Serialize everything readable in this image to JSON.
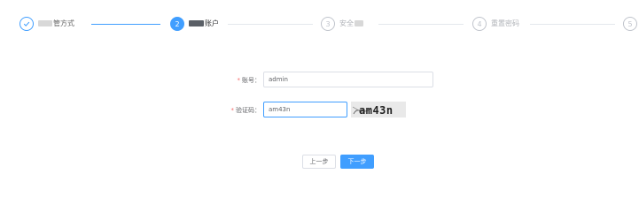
{
  "steps": [
    {
      "index": "1",
      "title": "管方式",
      "state": "done",
      "icon": "check-icon"
    },
    {
      "index": "2",
      "title": "账户",
      "state": "active"
    },
    {
      "index": "3",
      "title": "安全",
      "state": "pending"
    },
    {
      "index": "4",
      "title": "重置密码",
      "state": "pending"
    },
    {
      "index": "5",
      "title": "",
      "state": "pending"
    }
  ],
  "form": {
    "account_label": "账号：",
    "account_value": "admin",
    "captcha_label": "验证码：",
    "captcha_value": "am43n",
    "captcha_image_text": "am43n"
  },
  "buttons": {
    "prev_label": "上一步",
    "next_label": "下一步"
  },
  "colors": {
    "primary": "#409eff",
    "required": "#f56c6c"
  }
}
